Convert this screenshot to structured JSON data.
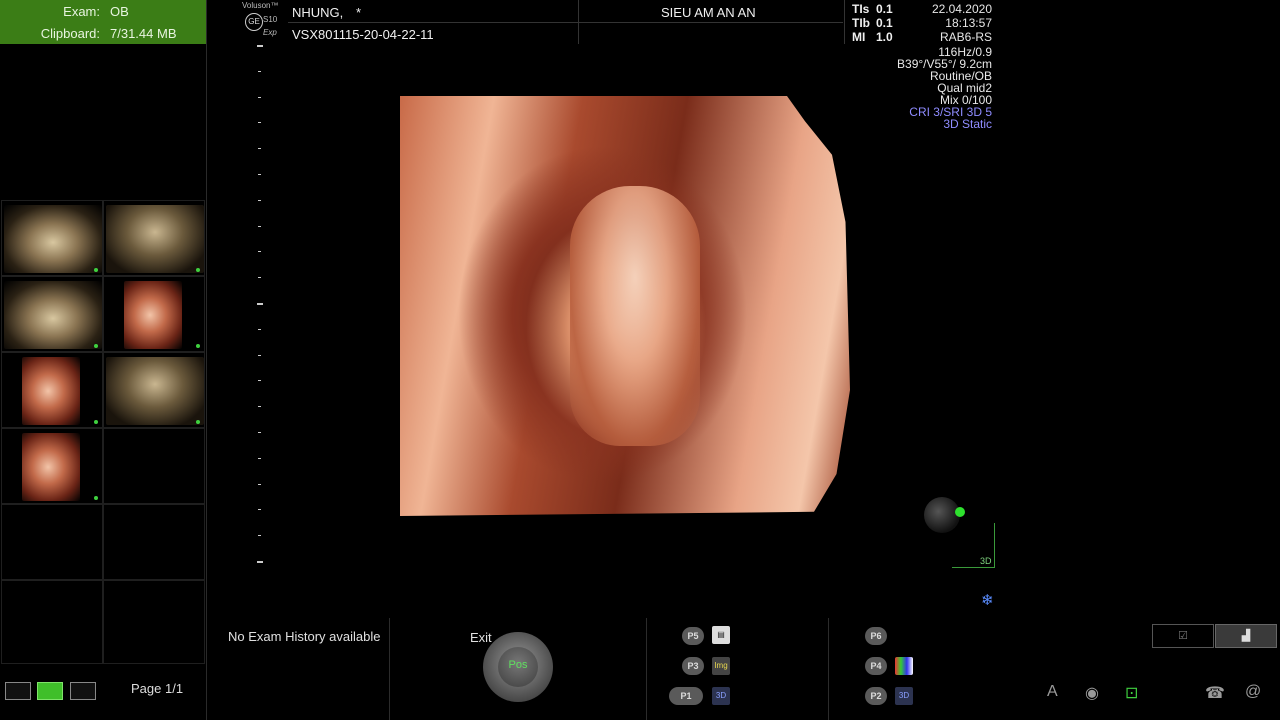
{
  "exam": {
    "label": "Exam:",
    "value": "OB"
  },
  "clipboard": {
    "label": "Clipboard:",
    "value": "7/31.44 MB"
  },
  "brand": {
    "line1": "Voluson™",
    "ge": "GE",
    "model": "S10",
    "edition": "Exp"
  },
  "patient": {
    "name": "NHUNG,",
    "flag": "*",
    "id": "VSX801115-20-04-22-11"
  },
  "clinic": "SIEU AM AN AN",
  "indices": [
    {
      "label": "TIs",
      "value": "0.1"
    },
    {
      "label": "TIb",
      "value": "0.1"
    },
    {
      "label": "MI",
      "value": "1.0"
    }
  ],
  "date": "22.04.2020",
  "time": "18:13:57",
  "probe": "RAB6-RS",
  "params": [
    "116Hz/0.9",
    "B39°/V55°/ 9.2cm",
    "Routine/OB",
    "Qual mid2",
    "Mix 0/100"
  ],
  "params_blue": [
    "CRI 3/SRI 3D 5",
    "3D Static"
  ],
  "orientation_label": "3D",
  "exam_history": "No Exam History available",
  "exit_label": "Exit",
  "knob_label": "Pos",
  "p_buttons": {
    "p5": "P5",
    "p3": "P3",
    "p1": "P1",
    "p6": "P6",
    "p4": "P4",
    "p2": "P2"
  },
  "icon_labels": {
    "img": "Img",
    "disk3d": "3D"
  },
  "page": "Page 1/1",
  "icons": {
    "snowflake": "snowflake-icon",
    "print": "print-icon",
    "image": "image-icon",
    "disk": "disk-icon",
    "text": "text-annotation-icon",
    "globe": "globe-icon",
    "probe": "probe-icon",
    "phone": "phone-icon",
    "at": "at-icon"
  },
  "colors": {
    "exam_bg": "#3b7d16",
    "active_green": "#3fbf2a",
    "blue_text": "#8f8cff"
  }
}
